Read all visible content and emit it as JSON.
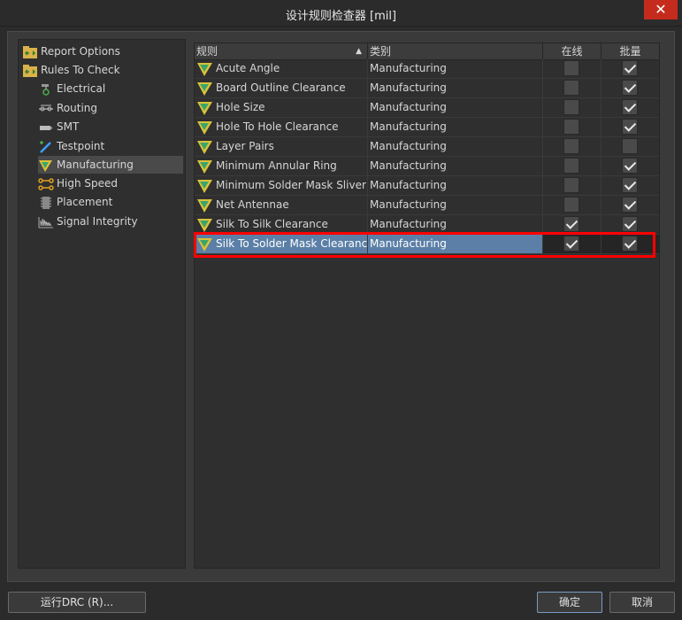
{
  "window": {
    "title": "设计规则检查器 [mil]",
    "close_glyph": "✕"
  },
  "tree": {
    "items": [
      {
        "label": "Report Options",
        "icon": "folder-arrows-icon"
      },
      {
        "label": "Rules To Check",
        "icon": "folder-arrows-icon"
      },
      {
        "label": "Electrical",
        "icon": "electrical-icon"
      },
      {
        "label": "Routing",
        "icon": "routing-icon"
      },
      {
        "label": "SMT",
        "icon": "smt-icon"
      },
      {
        "label": "Testpoint",
        "icon": "testpoint-icon"
      },
      {
        "label": "Manufacturing",
        "icon": "manufacturing-icon",
        "selected": true
      },
      {
        "label": "High Speed",
        "icon": "high-speed-icon"
      },
      {
        "label": "Placement",
        "icon": "placement-icon"
      },
      {
        "label": "Signal Integrity",
        "icon": "signal-integrity-icon"
      }
    ]
  },
  "table": {
    "columns": {
      "rule": "规则",
      "category": "类别",
      "online": "在线",
      "batch": "批量"
    },
    "rows": [
      {
        "rule": "Acute Angle",
        "category": "Manufacturing",
        "online": false,
        "batch": true
      },
      {
        "rule": "Board Outline Clearance",
        "category": "Manufacturing",
        "online": false,
        "batch": true
      },
      {
        "rule": "Hole Size",
        "category": "Manufacturing",
        "online": false,
        "batch": true
      },
      {
        "rule": "Hole To Hole Clearance",
        "category": "Manufacturing",
        "online": false,
        "batch": true
      },
      {
        "rule": "Layer Pairs",
        "category": "Manufacturing",
        "online": false,
        "batch": false
      },
      {
        "rule": "Minimum Annular Ring",
        "category": "Manufacturing",
        "online": false,
        "batch": true
      },
      {
        "rule": "Minimum Solder Mask Sliver",
        "category": "Manufacturing",
        "online": false,
        "batch": true
      },
      {
        "rule": "Net Antennae",
        "category": "Manufacturing",
        "online": false,
        "batch": true
      },
      {
        "rule": "Silk To Silk Clearance",
        "category": "Manufacturing",
        "online": true,
        "batch": true
      },
      {
        "rule": "Silk To Solder Mask Clearance",
        "category": "Manufacturing",
        "online": true,
        "batch": true,
        "selected": true
      }
    ]
  },
  "buttons": {
    "run_drc": "运行DRC (R)...",
    "ok": "确定",
    "cancel": "取消"
  },
  "colors": {
    "selection": "#5b7fa6",
    "highlight": "#ff0000",
    "close": "#c42b1c"
  }
}
